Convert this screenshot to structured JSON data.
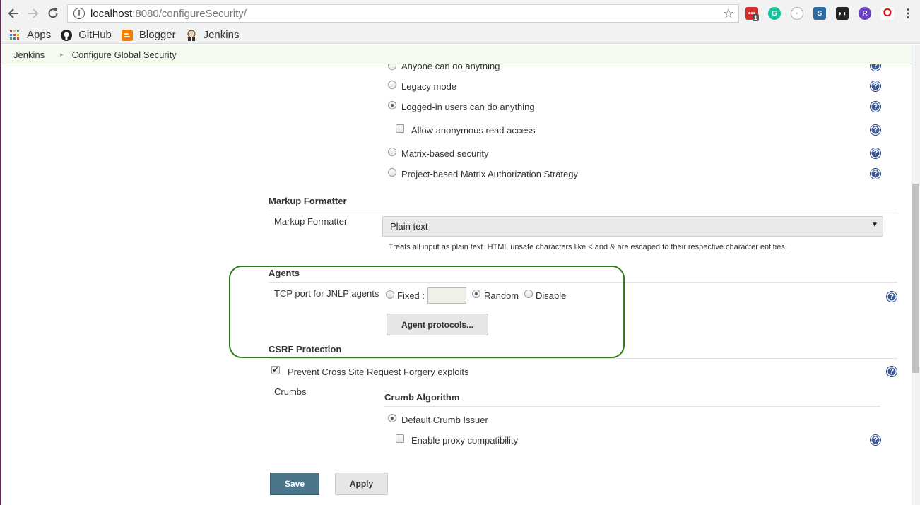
{
  "browser": {
    "url_host": "localhost",
    "url_rest": ":8080/configureSecurity/",
    "extension_badge": "1",
    "bookmarks": [
      {
        "label": "Apps",
        "icon": "apps-grid-icon"
      },
      {
        "label": "GitHub",
        "icon": "github-icon"
      },
      {
        "label": "Blogger",
        "icon": "blogger-icon"
      },
      {
        "label": "Jenkins",
        "icon": "jenkins-icon"
      }
    ]
  },
  "breadcrumb": {
    "root": "Jenkins",
    "current": "Configure Global Security"
  },
  "authorization": {
    "options": [
      {
        "label": "Anyone can do anything",
        "selected": false
      },
      {
        "label": "Legacy mode",
        "selected": false
      },
      {
        "label": "Logged-in users can do anything",
        "selected": true
      },
      {
        "label": "Matrix-based security",
        "selected": false
      },
      {
        "label": "Project-based Matrix Authorization Strategy",
        "selected": false
      }
    ],
    "anonymous_read_label": "Allow anonymous read access",
    "anonymous_read_checked": false
  },
  "markup_formatter": {
    "section_title": "Markup Formatter",
    "field_label": "Markup Formatter",
    "selected_value": "Plain text",
    "hint": "Treats all input as plain text. HTML unsafe characters like < and & are escaped to their respective character entities."
  },
  "agents": {
    "section_title": "Agents",
    "tcp_label": "TCP port for JNLP agents",
    "fixed_label": "Fixed :",
    "fixed_value": "",
    "random_label": "Random",
    "disable_label": "Disable",
    "selected": "Random",
    "protocols_button": "Agent protocols..."
  },
  "csrf": {
    "section_title": "CSRF Protection",
    "prevent_label": "Prevent Cross Site Request Forgery exploits",
    "prevent_checked": true,
    "crumbs_label": "Crumbs",
    "crumb_algorithm_title": "Crumb Algorithm",
    "default_issuer_label": "Default Crumb Issuer",
    "default_issuer_selected": true,
    "proxy_compat_label": "Enable proxy compatibility",
    "proxy_compat_checked": false
  },
  "actions": {
    "save_label": "Save",
    "apply_label": "Apply"
  },
  "colors": {
    "highlight_outline": "#2e7d16",
    "save_button": "#4b758b",
    "help_icon": "#3b5998"
  }
}
